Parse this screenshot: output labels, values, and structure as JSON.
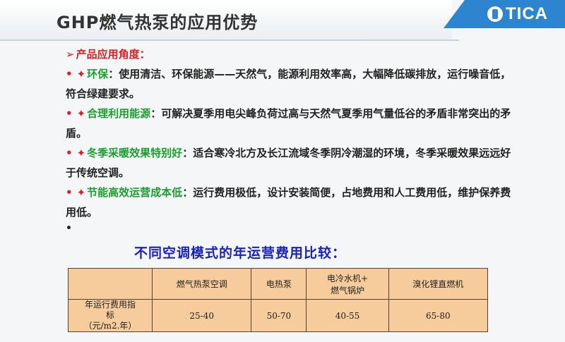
{
  "header": {
    "title": "GHP燃气热泵的应用优势",
    "logo_text": "TICA"
  },
  "section": {
    "arrow": "➢",
    "heading": "产品应用角度："
  },
  "bullet_symbol": "•",
  "cross_symbol": "✦",
  "items": [
    {
      "term": "环保",
      "text": "使用清洁、环保能源——天然气，能源利用效率高，大幅降低碳排放，运行噪音低，符合绿建要求。"
    },
    {
      "term": "合理利用能源",
      "text": "可解决夏季用电尖峰负荷过高与天然气夏季用气量低谷的矛盾非常突出的矛盾。"
    },
    {
      "term": "冬季采暖效果特别好",
      "text": "适合寒冷北方及长江流域冬季阴冷潮湿的环境，冬季采暖效果远远好于传统空调。"
    },
    {
      "term": "节能高效运营成本低",
      "text": "运行费用极低，设计安装简便，占地费用和人工费用低，维护保养费用低。"
    }
  ],
  "colon": "：",
  "trailing_dot": "•",
  "comparison": {
    "heading": "不同空调模式的年运营费用比较：",
    "columns": [
      "燃气热泵空调",
      "电热泵",
      "电冷水机+燃气锅炉",
      "溴化锂直燃机"
    ],
    "row_label": "年运行费用指标（元/m2.年）",
    "row_label_lines": [
      "年运行费用指",
      "标",
      "（元/m2.年）"
    ],
    "values": [
      "25-40",
      "50-70",
      "40-55",
      "65-80"
    ]
  }
}
